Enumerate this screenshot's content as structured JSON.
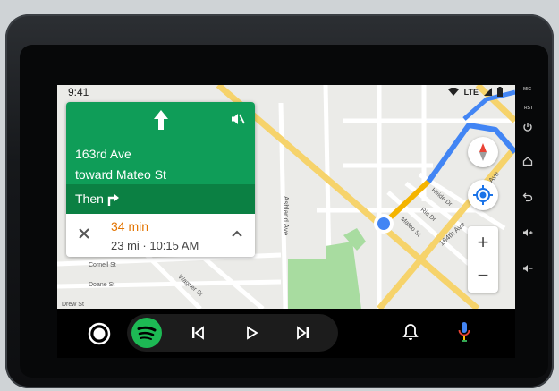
{
  "status": {
    "time": "9:41",
    "network": "LTE"
  },
  "navigation": {
    "street": "163rd Ave",
    "toward": "toward Mateo St",
    "then_label": "Then",
    "eta_time": "34 min",
    "eta_detail": "23 mi · 10:15 AM"
  },
  "map": {
    "street_labels": [
      "Ashland Ave",
      "Wagner St",
      "Cornell St",
      "Doane St",
      "Drew St",
      "164th Ave",
      "4th Ave",
      "Heide Dr",
      "Ria Dr",
      "Mateo St"
    ],
    "zoom_in": "+",
    "zoom_out": "−"
  },
  "hardware_buttons": {
    "mic_label": "MIC",
    "rst_label": "RST"
  },
  "colors": {
    "nav_green": "#0f9d58",
    "nav_dark_green": "#0b8043",
    "route_blue": "#4285f4",
    "eta_orange": "#e37400",
    "spotify_green": "#1db954"
  },
  "icons": [
    "arrow-up-icon",
    "mute-icon",
    "turn-right-icon",
    "close-icon",
    "chevron-up-icon",
    "compass-icon",
    "locate-icon",
    "home-button-icon",
    "spotify-icon",
    "previous-track-icon",
    "play-icon",
    "next-track-icon",
    "bell-icon",
    "microphone-icon",
    "power-icon",
    "home-hw-icon",
    "back-icon",
    "volume-up-icon",
    "volume-down-icon"
  ]
}
